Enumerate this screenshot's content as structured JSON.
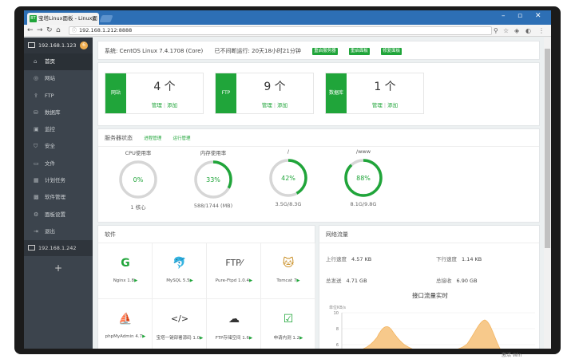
{
  "browser": {
    "tab_title": "宝塔Linux面板 - Linux面",
    "url": "192.168.1.212:8888"
  },
  "sidebar": {
    "server_ip": "192.168.1.123",
    "badge": "6",
    "items": [
      {
        "label": "首页",
        "icon": "home-icon"
      },
      {
        "label": "网站",
        "icon": "globe-icon"
      },
      {
        "label": "FTP",
        "icon": "ftp-icon"
      },
      {
        "label": "数据库",
        "icon": "database-icon"
      },
      {
        "label": "监控",
        "icon": "monitor-icon"
      },
      {
        "label": "安全",
        "icon": "shield-icon"
      },
      {
        "label": "文件",
        "icon": "folder-icon"
      },
      {
        "label": "计划任务",
        "icon": "calendar-icon"
      },
      {
        "label": "软件管理",
        "icon": "grid-icon"
      },
      {
        "label": "面板设置",
        "icon": "gear-icon"
      },
      {
        "label": "退出",
        "icon": "logout-icon"
      }
    ],
    "server2_ip": "192.168.1.242",
    "add_label": "+"
  },
  "system": {
    "os": "系统: CentOS Linux 7.4.1708 (Core)",
    "uptime": "已不间断运行: 20天18小时21分钟",
    "buttons": [
      "重启服务器",
      "重启面板",
      "修复面板"
    ]
  },
  "stats": [
    {
      "label": "网站",
      "count": "4 个",
      "manage": "管理",
      "add": "添加"
    },
    {
      "label": "FTP",
      "count": "9 个",
      "manage": "管理",
      "add": "添加"
    },
    {
      "label": "数据库",
      "count": "1 个",
      "manage": "管理",
      "add": "添加"
    }
  ],
  "status": {
    "title": "服务器状态",
    "link1": "进程管理",
    "link2": "运行管理",
    "gauges": [
      {
        "title": "CPU使用率",
        "value": "0%",
        "percent": 0,
        "bottom": "1 核心"
      },
      {
        "title": "内存使用率",
        "value": "33%",
        "percent": 33,
        "bottom": "588/1744 (MB)"
      },
      {
        "title": "/",
        "value": "42%",
        "percent": 42,
        "bottom": "3.5G/8.3G"
      },
      {
        "title": "/www",
        "value": "88%",
        "percent": 88,
        "bottom": "8.1G/9.8G"
      }
    ]
  },
  "software": {
    "title": "软件",
    "items": [
      {
        "name": "Nginx 1.8",
        "icon": "nginx-icon"
      },
      {
        "name": "MySQL 5.5",
        "icon": "mysql-icon"
      },
      {
        "name": "Pure-Ftpd 1.0.4",
        "icon": "ftp-text-icon"
      },
      {
        "name": "Tomcat 7",
        "icon": "tomcat-icon"
      },
      {
        "name": "phpMyAdmin 4.7",
        "icon": "phpmyadmin-icon"
      },
      {
        "name": "宝塔一键部署源码 1.0",
        "icon": "code-icon"
      },
      {
        "name": "FTP存储空间 1.6",
        "icon": "cloud-ftp-icon"
      },
      {
        "name": "申请内测 1.2",
        "icon": "clipboard-icon"
      }
    ]
  },
  "network": {
    "title": "网络流量",
    "up_label": "上行速度",
    "up_value": "4.57 KB",
    "down_label": "下行速度",
    "down_value": "1.14 KB",
    "sent_label": "总发送",
    "sent_value": "4.71 GB",
    "recv_label": "总接收",
    "recv_value": "6.90 GB",
    "chart_title": "接口流量实时",
    "unit": "单位KB/s",
    "y_ticks": [
      "10",
      "8",
      "6"
    ]
  },
  "colors": {
    "accent": "#20a53a",
    "sidebar": "#3c444d",
    "chart_fill": "#f7c98b"
  },
  "watermark": "激活 Win"
}
